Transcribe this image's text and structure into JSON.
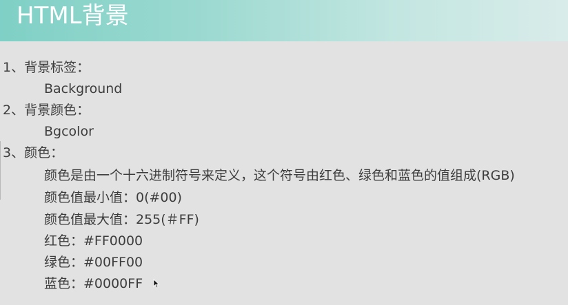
{
  "title": "HTML背景",
  "sections": [
    {
      "heading": "1、背景标签：",
      "lines": [
        "Background"
      ]
    },
    {
      "heading": "2、背景颜色：",
      "lines": [
        "Bgcolor"
      ]
    },
    {
      "heading": "3、颜色：",
      "lines": [
        "颜色是由一个十六进制符号来定义，这个符号由红色、绿色和蓝色的值组成(RGB)",
        "颜色值最小值：0(#00)",
        "颜色值最大值：255(＃FF)",
        "红色：#FF0000",
        "绿色：#00FF00",
        "蓝色：#0000FF"
      ]
    }
  ],
  "icons": {
    "cursor": "mouse-pointer-icon"
  }
}
